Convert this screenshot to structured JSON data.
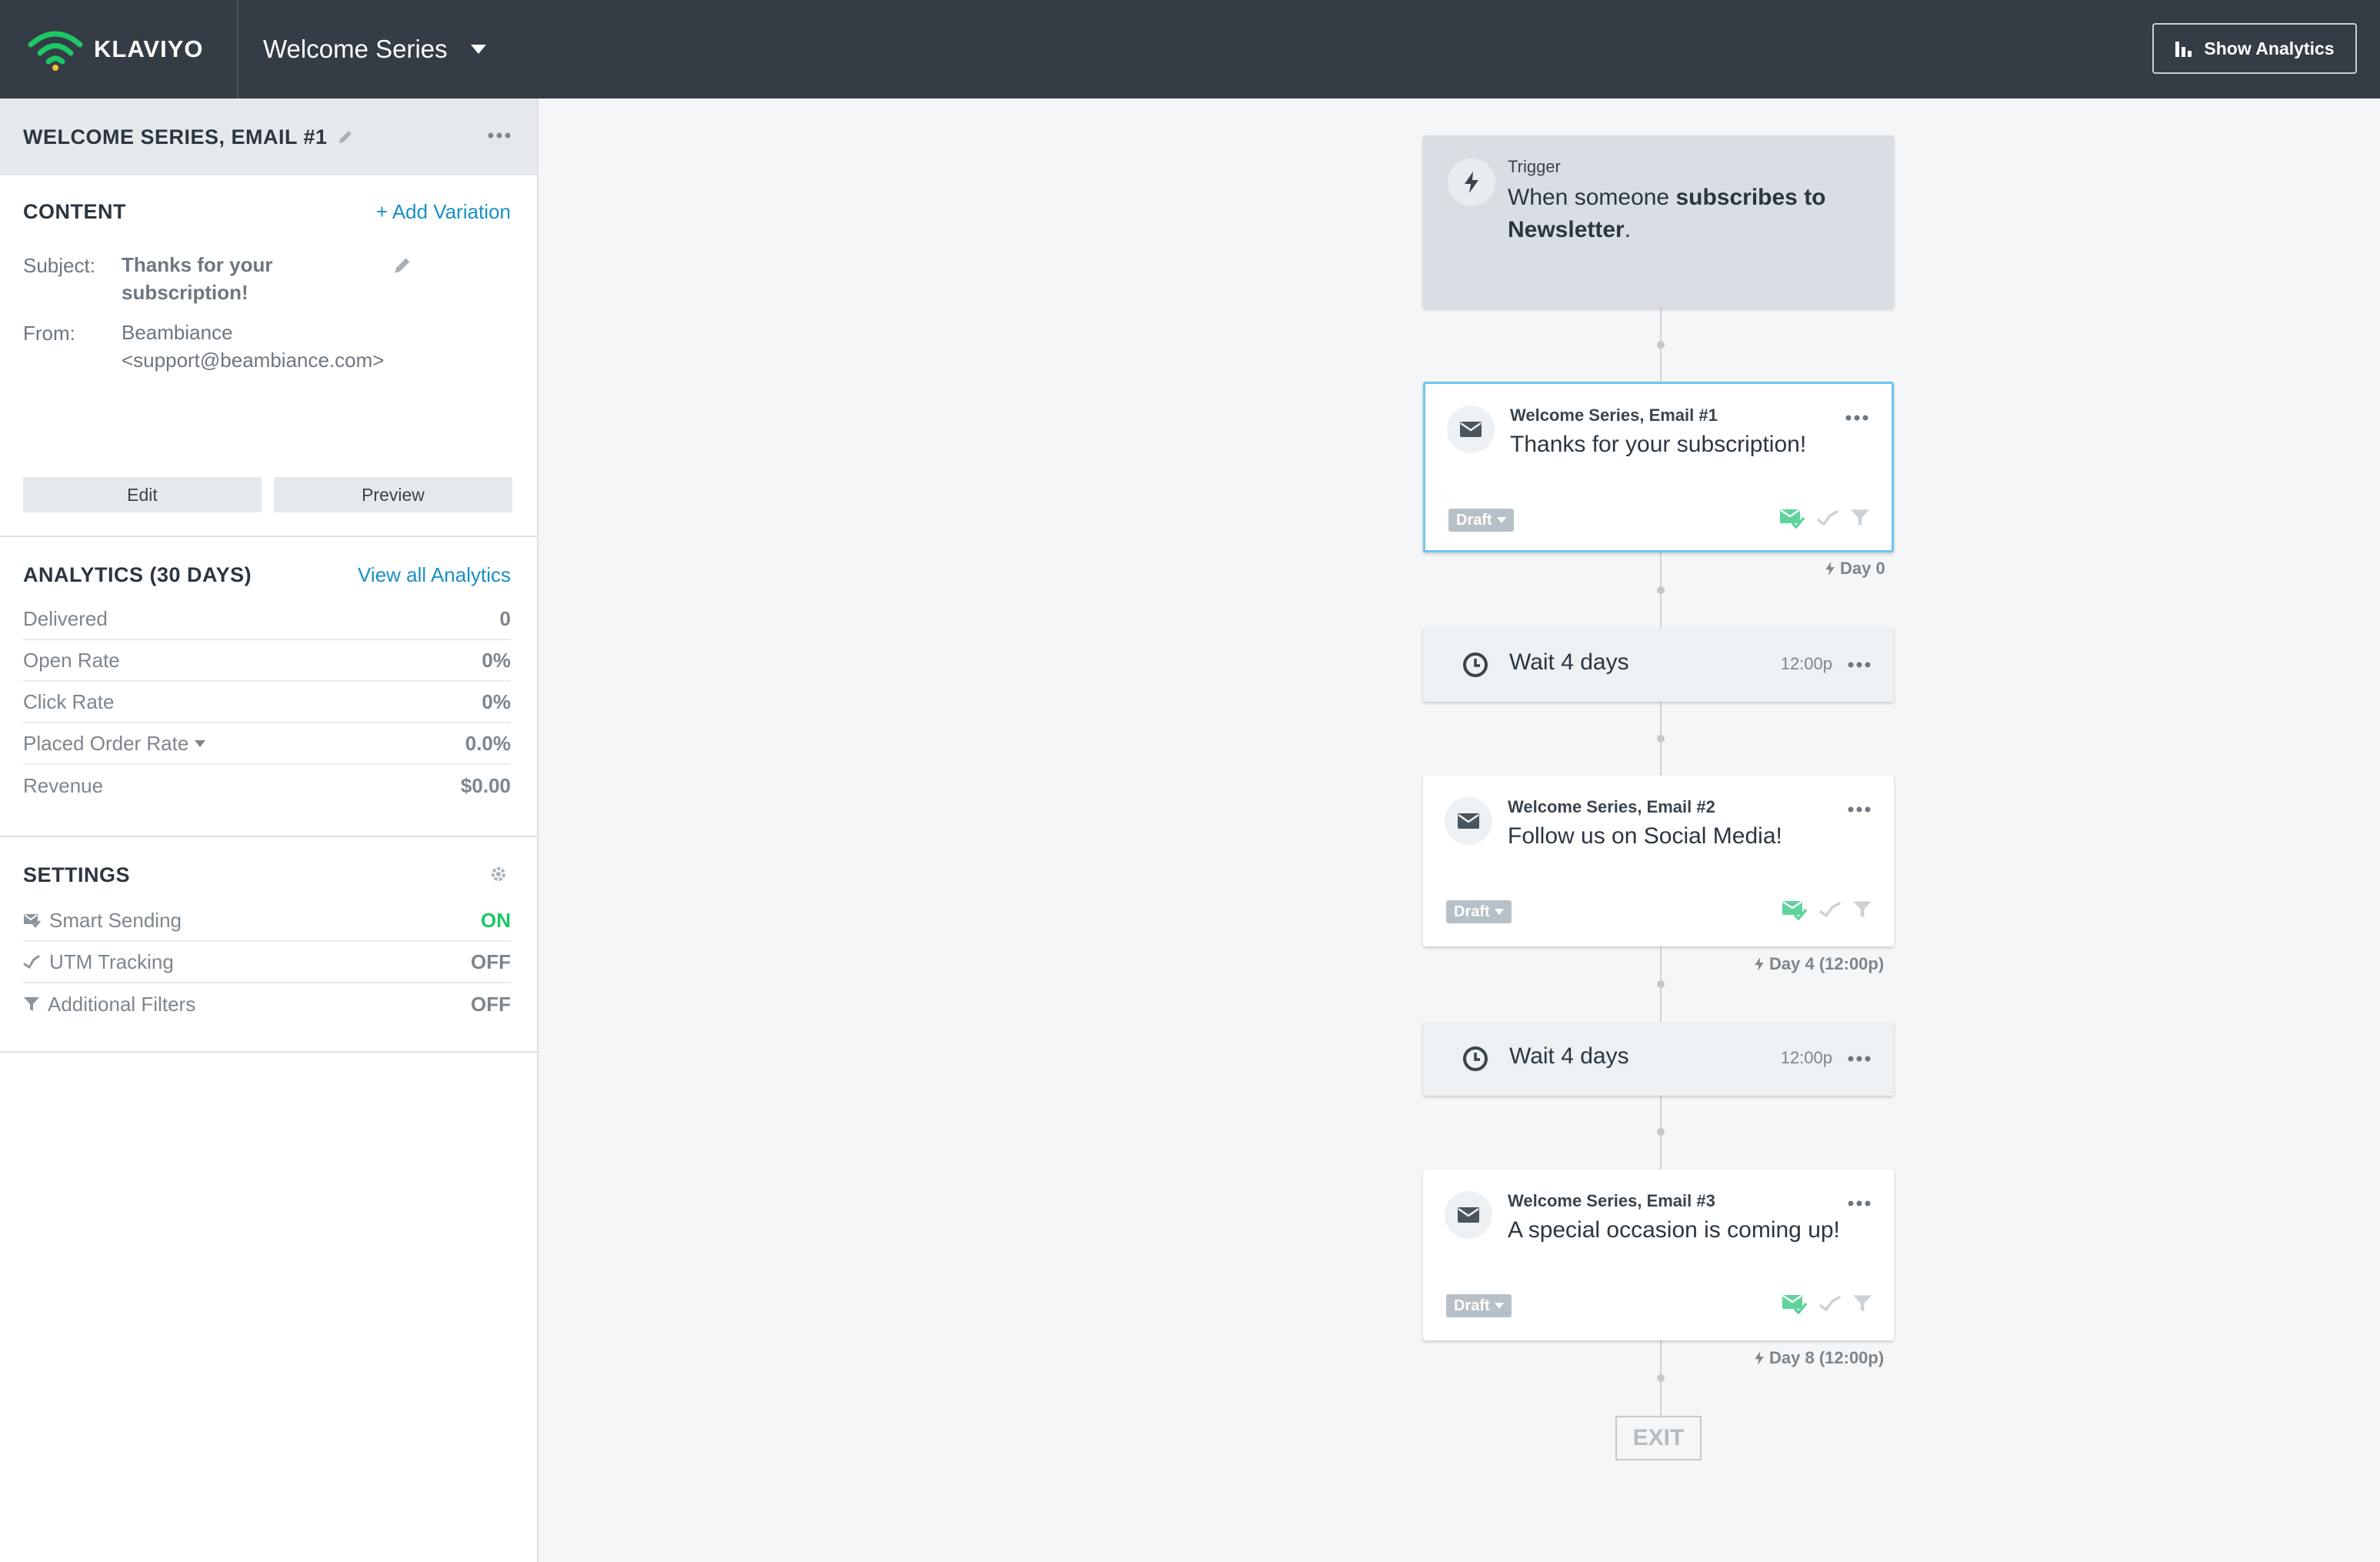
{
  "topbar": {
    "brand": "KLAVIYO",
    "flow_title": "Welcome Series",
    "show_analytics": "Show Analytics"
  },
  "sidebar": {
    "header_title": "WELCOME SERIES, EMAIL #1",
    "content": {
      "title": "CONTENT",
      "add_variation": "+ Add Variation",
      "subject_label": "Subject:",
      "subject_value": "Thanks for your subscription!",
      "from_label": "From:",
      "from_name": "Beambiance",
      "from_email": "<support@beambiance.com>",
      "edit": "Edit",
      "preview": "Preview"
    },
    "analytics": {
      "title": "ANALYTICS (30 DAYS)",
      "view_all": "View all Analytics",
      "rows": [
        {
          "label": "Delivered",
          "value": "0"
        },
        {
          "label": "Open Rate",
          "value": "0%"
        },
        {
          "label": "Click Rate",
          "value": "0%"
        },
        {
          "label": "Placed Order Rate",
          "value": "0.0%"
        },
        {
          "label": "Revenue",
          "value": "$0.00"
        }
      ]
    },
    "settings": {
      "title": "SETTINGS",
      "rows": [
        {
          "label": "Smart Sending",
          "value": "ON"
        },
        {
          "label": "UTM Tracking",
          "value": "OFF"
        },
        {
          "label": "Additional Filters",
          "value": "OFF"
        }
      ]
    }
  },
  "flow": {
    "trigger": {
      "label": "Trigger",
      "prefix": "When someone ",
      "bold": "subscribes to Newsletter",
      "suffix": "."
    },
    "emails": [
      {
        "name": "Welcome Series, Email #1",
        "subject": "Thanks for your subscription!",
        "status": "Draft",
        "day": "Day 0"
      },
      {
        "name": "Welcome Series, Email #2",
        "subject": "Follow us on Social Media!",
        "status": "Draft",
        "day": "Day 4 (12:00p)"
      },
      {
        "name": "Welcome Series, Email #3",
        "subject": "A special occasion is coming up!",
        "status": "Draft",
        "day": "Day 8 (12:00p)"
      }
    ],
    "waits": [
      {
        "text": "Wait 4 days",
        "time": "12:00p"
      },
      {
        "text": "Wait 4 days",
        "time": "12:00p"
      }
    ],
    "exit": "EXIT"
  },
  "colors": {
    "topbar": "#343c45",
    "accent_blue": "#1a8fc7",
    "on_green": "#1ec765",
    "selected_border": "#6ec6ee"
  }
}
